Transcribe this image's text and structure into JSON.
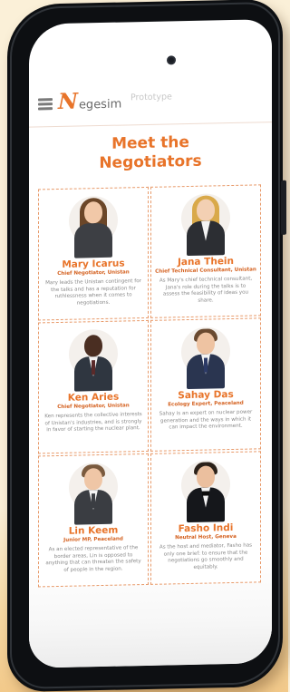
{
  "nav": {
    "brand_initial": "N",
    "brand_rest": "egesim",
    "link": "Prototype"
  },
  "page": {
    "title_line1": "Meet the",
    "title_line2": "Negotiators"
  },
  "colors": {
    "accent": "#e8742a",
    "role": "#d4601e",
    "card_border": "#e89a6a"
  },
  "negotiators": [
    {
      "name": "Mary Icarus",
      "role": "Chief Negotiator, Unistan",
      "bio": "Mary leads the Unistan contingent for the talks and has a reputation for ruthlessness when it comes to negotiations."
    },
    {
      "name": "Jana Thein",
      "role": "Chief Technical Consultant, Unistan",
      "bio": "As Mary's chief technical consultant, Jana's role during the talks is to assess the feasibility of ideas you share."
    },
    {
      "name": "Ken Aries",
      "role": "Chief Negotiator, Unistan",
      "bio": "Ken represents the collective interests of Unistan's industries, and is strongly in favor of starting the nuclear plant."
    },
    {
      "name": "Sahay Das",
      "role": "Ecology Expert, Peaceland",
      "bio": "Sahay is an expert on nuclear power generation and the ways in which it can impact the environment."
    },
    {
      "name": "Lin Keem",
      "role": "Junior MP, Peaceland",
      "bio": "As an elected representative of the border areas, Lin is opposed to anything that can threaten the safety of people in the region."
    },
    {
      "name": "Fasho Indi",
      "role": "Neutral Host, Geneva",
      "bio": "As the host and mediator, Fasho has only one brief: to ensure that the negotiations go smoothly and equitably."
    }
  ]
}
